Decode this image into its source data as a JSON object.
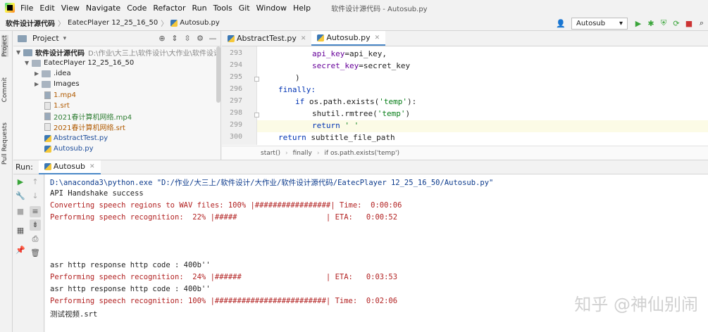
{
  "menubar": {
    "items": [
      "File",
      "Edit",
      "View",
      "Navigate",
      "Code",
      "Refactor",
      "Run",
      "Tools",
      "Git",
      "Window",
      "Help"
    ],
    "window_title": "软件设计源代码 - Autosub.py"
  },
  "navbar": {
    "crumbs": [
      "软件设计源代码",
      "EatecPlayer 12_25_16_50",
      "Autosub.py"
    ],
    "run_config": "Autosub"
  },
  "leftstrip": {
    "tabs": [
      "Project",
      "Commit",
      "Pull Requests"
    ]
  },
  "project": {
    "title": "Project",
    "root_name": "软件设计源代码",
    "root_path": "D:\\作业\\大三上\\软件设计\\大作业\\软件设计源代",
    "tree": [
      {
        "label": "EatecPlayer 12_25_16_50"
      },
      {
        "label": ".idea"
      },
      {
        "label": "Images"
      },
      {
        "label": "1.mp4"
      },
      {
        "label": "1.srt"
      },
      {
        "label": "2021春计算机网络.mp4"
      },
      {
        "label": "2021春计算机网络.srt"
      },
      {
        "label": "AbstractTest.py"
      },
      {
        "label": "Autosub.py"
      }
    ]
  },
  "editor": {
    "tabs": [
      {
        "label": "AbstractTest.py"
      },
      {
        "label": "Autosub.py"
      }
    ],
    "line_numbers": [
      "293",
      "294",
      "295",
      "296",
      "297",
      "298",
      "299",
      "300"
    ],
    "code": {
      "l293_a": "api_key",
      "l293_b": "=api_key,",
      "l294_a": "secret_key",
      "l294_b": "=secret_key",
      "l295": ")",
      "l296": "finally:",
      "l297_kw": "if",
      "l297_a": " os.path.exists(",
      "l297_str": "'temp'",
      "l297_b": "):",
      "l298_a": "shutil.rmtree(",
      "l298_str": "'temp'",
      "l298_b": ")",
      "l299_kw": "return",
      "l299_str": " ' '",
      "l300_kw": "return",
      "l300_a": " subtitle_file_path"
    },
    "breadcrumbs": [
      "start()",
      "finally",
      "if os.path.exists('temp')"
    ]
  },
  "run": {
    "label": "Run:",
    "tab": "Autosub",
    "lines": [
      "D:\\anaconda3\\python.exe \"D:/作业/大三上/软件设计/大作业/软件设计源代码/EatecPlayer 12_25_16_50/Autosub.py\"",
      "API Handshake success",
      "Converting speech regions to WAV files: 100% |#################| Time:  0:00:06",
      "Performing speech recognition:  22% |#####                    | ETA:   0:00:52",
      "asr http response http code : 400b''",
      "Performing speech recognition:  24% |######                   | ETA:   0:03:53",
      "asr http response http code : 400b''",
      "Performing speech recognition: 100% |#########################| Time:  0:02:06",
      "测试视频.srt"
    ]
  },
  "watermark": "知乎 @神仙别闹"
}
